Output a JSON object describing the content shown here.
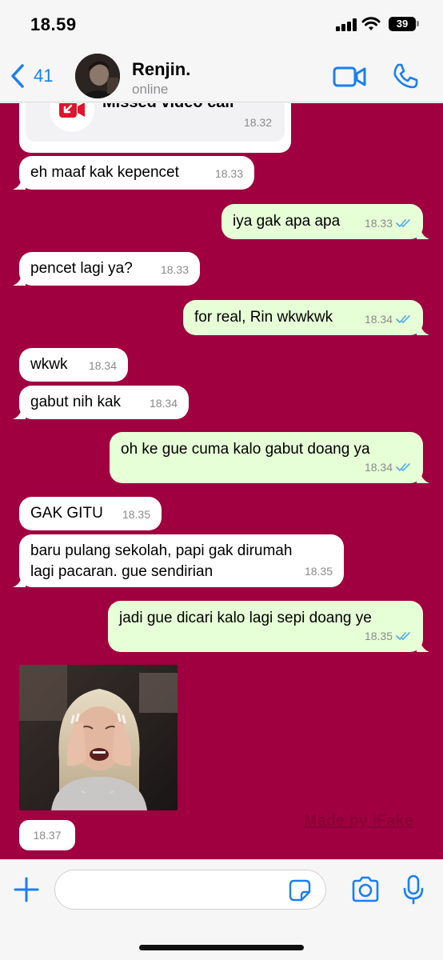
{
  "status_bar": {
    "time": "18.59",
    "battery": "39"
  },
  "header": {
    "back_count": "41",
    "contact_name": "Renjin.",
    "contact_status": "online"
  },
  "missed_call": {
    "label": "Missed video call",
    "time": "18.32"
  },
  "messages": [
    {
      "dir": "in",
      "text": "eh maaf kak kepencet",
      "time": "18.33"
    },
    {
      "dir": "out",
      "text": "iya gak apa apa",
      "time": "18.33",
      "read": true
    },
    {
      "dir": "in",
      "text": "pencet lagi ya?",
      "time": "18.33"
    },
    {
      "dir": "out",
      "text": "for real, Rin wkwkwk",
      "time": "18.34",
      "read": true
    },
    {
      "dir": "in",
      "text": "wkwk",
      "time": "18.34"
    },
    {
      "dir": "in",
      "text": "gabut nih kak",
      "time": "18.34"
    },
    {
      "dir": "out",
      "text": "oh ke gue cuma kalo gabut doang ya",
      "time": "18.34",
      "read": true
    },
    {
      "dir": "in",
      "text": "GAK GITU",
      "time": "18.35"
    },
    {
      "dir": "in",
      "text": "baru pulang sekolah, papi gak dirumah\nlagi pacaran. gue sendirian",
      "time": "18.35"
    },
    {
      "dir": "out",
      "text": "jadi gue dicari kalo lagi sepi doang ye",
      "time": "18.35",
      "read": true
    }
  ],
  "image_message": {
    "time": "18.37"
  },
  "watermark": "Made by iFake",
  "composer": {
    "value": "",
    "placeholder": ""
  },
  "colors": {
    "chat_bg": "#a0003f",
    "outgoing": "#e6ffd7",
    "accent": "#1a7ff0",
    "missed": "#e0142c",
    "ticks": "#4fa9e8"
  }
}
